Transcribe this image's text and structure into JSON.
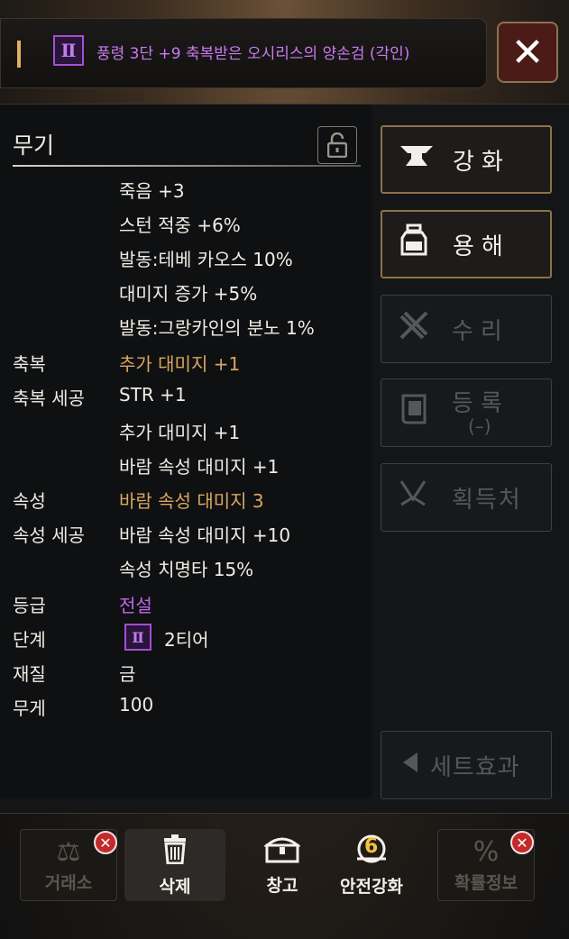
{
  "header": {
    "tier_symbol": "Ⅱ",
    "item_name": "풍령 3단 +9 축복받은 오시리스의 양손검 (각인)",
    "close_symbol": "✕"
  },
  "stats": {
    "category": "무기",
    "lock_symbol": "🔓",
    "rows": [
      {
        "label": "",
        "value": "죽음 +3"
      },
      {
        "label": "",
        "value": "스턴 적중 +6%"
      },
      {
        "label": "",
        "value": "발동:테베 카오스 10%"
      },
      {
        "label": "",
        "value": "대미지 증가 +5%"
      },
      {
        "label": "",
        "value": "발동:그랑카인의 분노 1%"
      },
      {
        "label": "축복",
        "value": "추가 대미지 +1"
      },
      {
        "label": "축복 세공",
        "value": "STR +1"
      },
      {
        "label": "",
        "value": "추가 대미지 +1"
      },
      {
        "label": "",
        "value": "바람 속성 대미지 +1"
      },
      {
        "label": "속성",
        "value": "바람 속성 대미지  3"
      },
      {
        "label": "속성 세공",
        "value": "바람 속성 대미지 +10"
      },
      {
        "label": "",
        "value": "속성 치명타 15%"
      },
      {
        "label": "등급",
        "value": "전설"
      },
      {
        "label": "단계",
        "value": "2티어",
        "tier_symbol": "Ⅱ"
      },
      {
        "label": "재질",
        "value": "금"
      },
      {
        "label": "무게",
        "value": "100"
      }
    ]
  },
  "side_buttons": {
    "enhance": {
      "label": "강화",
      "icon": "anvil-icon",
      "state": "active"
    },
    "dissolve": {
      "label": "용해",
      "icon": "jar-icon",
      "state": "active"
    },
    "repair": {
      "label": "수리",
      "icon": "tools-icon",
      "state": "disabled"
    },
    "register": {
      "label": "등록",
      "sub": "(–)",
      "icon": "book-icon",
      "state": "disabled"
    },
    "acquire": {
      "label": "획득처",
      "icon": "location-icon",
      "state": "disabled"
    },
    "set_effect": {
      "label": "세트효과",
      "icon": "triangle-left-icon",
      "state": "disabled"
    }
  },
  "bottom_buttons": {
    "exchange": {
      "label": "거래소",
      "icon": "scales-icon",
      "state": "disabled"
    },
    "delete": {
      "label": "삭제",
      "icon": "trash-icon",
      "state": "enabled"
    },
    "storage": {
      "label": "창고",
      "icon": "chest-icon",
      "state": "enabled"
    },
    "safe_enhance": {
      "label": "안전강화",
      "icon": "safe-enhance-icon",
      "badge": "6",
      "state": "enabled"
    },
    "probability": {
      "label": "확률정보",
      "icon": "percent-icon",
      "state": "disabled"
    }
  },
  "colors": {
    "gold_text": "#d9a661",
    "legend_purple": "#c068ef",
    "close_bg": "#4b1b17",
    "disabled_badge": "#c42a2a"
  }
}
